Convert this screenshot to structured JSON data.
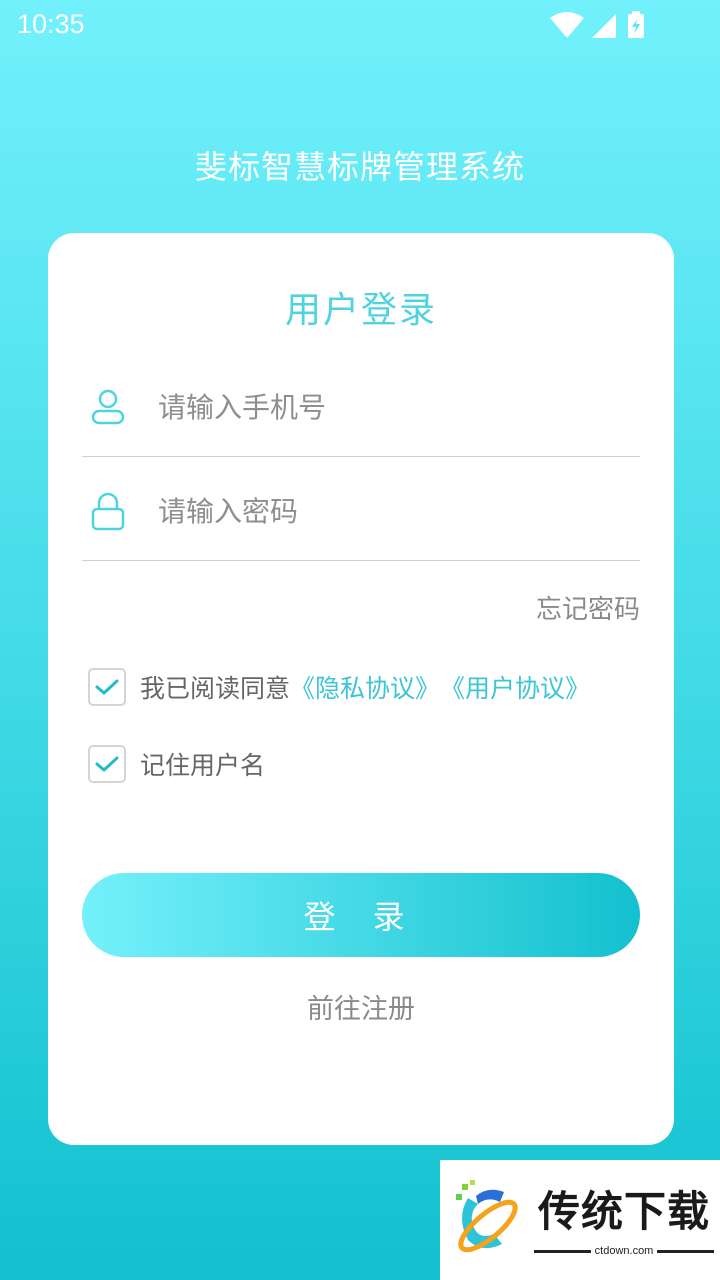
{
  "status_bar": {
    "time": "10:35"
  },
  "app_title": "斐标智慧标牌管理系统",
  "login_card": {
    "title": "用户登录",
    "phone_placeholder": "请输入手机号",
    "password_placeholder": "请输入密码",
    "forgot_password": "忘记密码",
    "agree_text": "我已阅读同意",
    "privacy_link": "《隐私协议》",
    "user_agreement_link": "《用户协议》",
    "agree_checked": true,
    "remember_label": "记住用户名",
    "remember_checked": true,
    "login_button": "登 录",
    "register_link": "前往注册"
  },
  "watermark": {
    "name": "传统下载",
    "url": "ctdown.com"
  },
  "colors": {
    "accent": "#4fd3e0",
    "link": "#3cc6d4",
    "button_start": "#74f1fb",
    "button_end": "#14c0cf"
  }
}
